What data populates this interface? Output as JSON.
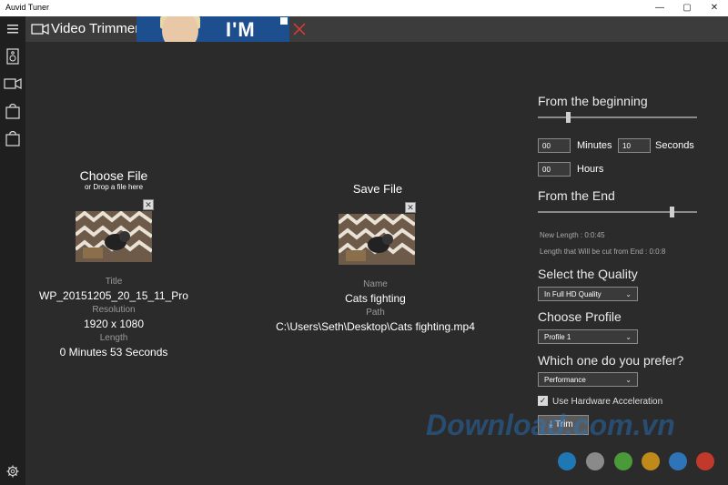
{
  "window": {
    "title": "Auvid Tuner",
    "controls": [
      "—",
      "▢",
      "✕"
    ]
  },
  "header": {
    "title": "Video Trimmer",
    "ad_text": "I'M"
  },
  "rail": {
    "icons": [
      "hamburger-icon",
      "speaker-icon",
      "video-icon",
      "bag-icon",
      "bag-icon",
      "settings-icon"
    ]
  },
  "choose": {
    "heading": "Choose File",
    "subheading": "or Drop a file here",
    "title_label": "Title",
    "title_value": "WP_20151205_20_15_11_Pro",
    "resolution_label": "Resolution",
    "resolution_value": "1920 x 1080",
    "length_label": "Length",
    "length_value": "0 Minutes 53 Seconds"
  },
  "save": {
    "heading": "Save File",
    "name_label": "Name",
    "name_value": "Cats fighting",
    "path_label": "Path",
    "path_value": "C:\\Users\\Seth\\Desktop\\Cats fighting.mp4"
  },
  "settings": {
    "from_beginning": "From the beginning",
    "minutes_value": "00",
    "minutes_label": "Minutes",
    "seconds_value": "10",
    "seconds_label": "Seconds",
    "hours_value": "00",
    "hours_label": "Hours",
    "from_end": "From the End",
    "new_length": "New Length :  0:0:45",
    "cut_length": "Length that Will be cut from End :   0:0:8",
    "quality_heading": "Select the Quality",
    "quality_value": "In Full HD Quality",
    "profile_heading": "Choose Profile",
    "profile_value": "Profile 1",
    "prefer_heading": "Which one do you prefer?",
    "prefer_value": "Performance",
    "hw_accel_label": "Use Hardware Acceleration",
    "trim_label": "Trim"
  },
  "watermark": {
    "text": "Download.com.vn",
    "dot_colors": [
      "#1f78b4",
      "#8a8a8a",
      "#4a9a3a",
      "#c08a1a",
      "#2f73b8",
      "#c0392b"
    ]
  }
}
